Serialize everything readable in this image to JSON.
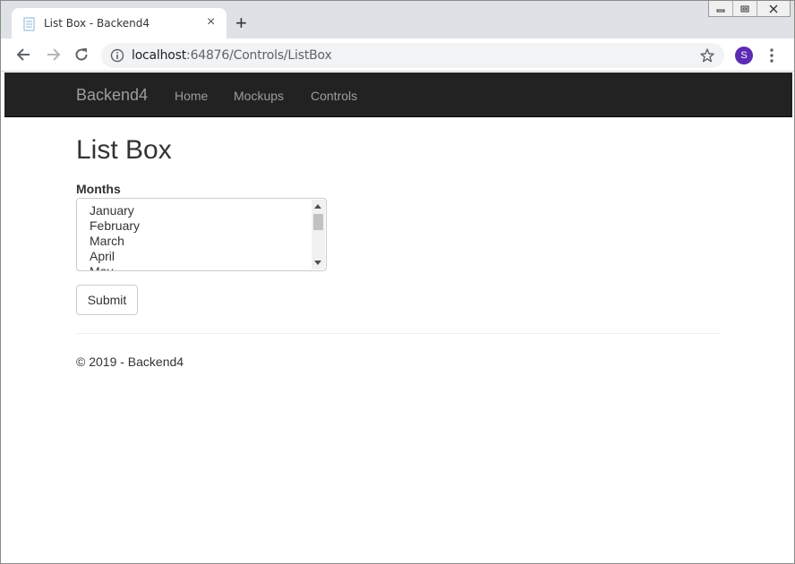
{
  "browser": {
    "tab_title": "List Box - Backend4",
    "tab_close": "×",
    "new_tab": "+",
    "url_host": "localhost",
    "url_rest": ":64876/Controls/ListBox",
    "avatar_initial": "S",
    "avatar_color": "#5c2bb3"
  },
  "navbar": {
    "brand": "Backend4",
    "links": [
      "Home",
      "Mockups",
      "Controls"
    ],
    "background": "#222222",
    "text_color": "#9d9d9d"
  },
  "main": {
    "title": "List Box",
    "field_label": "Months",
    "listbox_options": [
      "January",
      "February",
      "March",
      "April",
      "May"
    ],
    "submit_label": "Submit"
  },
  "footer": {
    "text": "© 2019 - Backend4"
  }
}
